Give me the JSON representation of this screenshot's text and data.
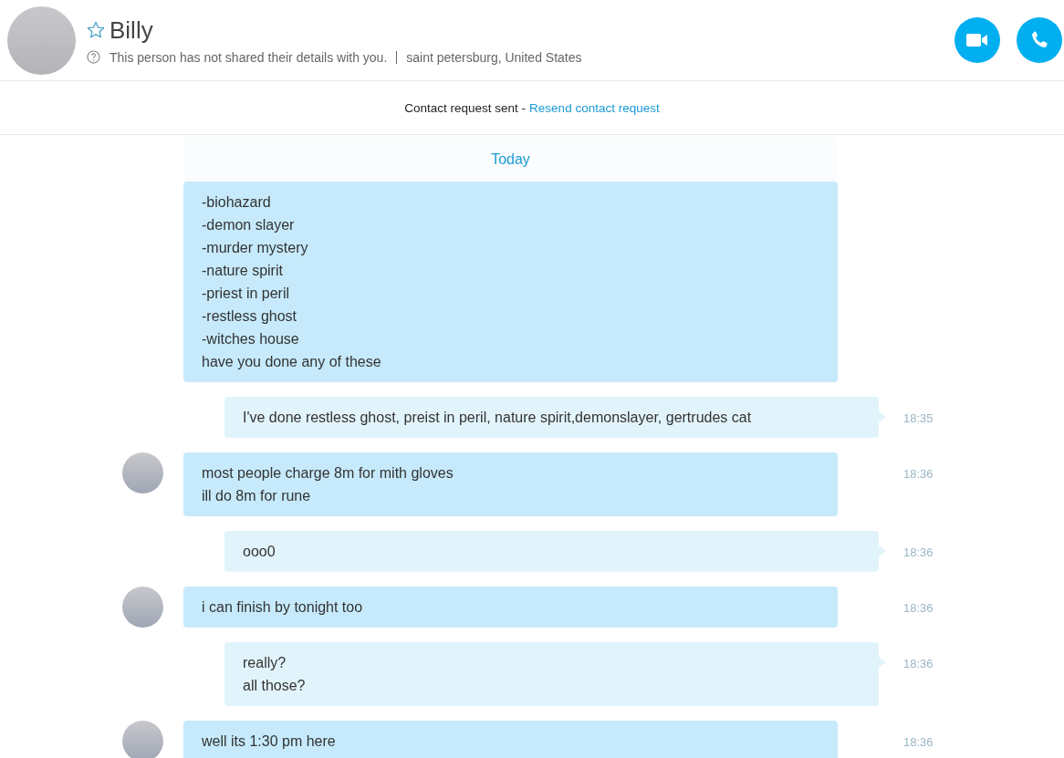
{
  "contact": {
    "name": "Billy",
    "favorite": false,
    "status": "This person has not shared their details with you.",
    "location": "saint petersburg, United States"
  },
  "request_bar": {
    "text": "Contact request sent -",
    "link": "Resend contact request"
  },
  "date_divider": "Today",
  "messages": [
    {
      "kind": "received",
      "avatar": false,
      "lines": [
        "-biohazard",
        "-demon slayer",
        "-murder mystery",
        "-nature spirit",
        "-priest in peril",
        "-restless ghost",
        "-witches house",
        "have you done any of these"
      ]
    },
    {
      "kind": "sent",
      "avatar": false,
      "lines": [
        "I've done restless ghost, preist in peril, nature spirit,demonslayer, gertrudes cat"
      ],
      "time": "18:35"
    },
    {
      "kind": "received",
      "avatar": true,
      "lines": [
        "most people charge 8m for mith gloves",
        "ill do 8m for rune"
      ],
      "time": "18:36"
    },
    {
      "kind": "sent",
      "avatar": false,
      "lines": [
        "ooo0"
      ],
      "time": "18:36"
    },
    {
      "kind": "received",
      "avatar": true,
      "lines": [
        "i can finish by tonight too"
      ],
      "time": "18:36"
    },
    {
      "kind": "sent",
      "avatar": false,
      "lines": [
        "really?",
        "all those?"
      ],
      "time": "18:36"
    },
    {
      "kind": "received",
      "avatar": true,
      "lines": [
        "well its 1:30 pm here"
      ],
      "time": "18:36"
    }
  ]
}
